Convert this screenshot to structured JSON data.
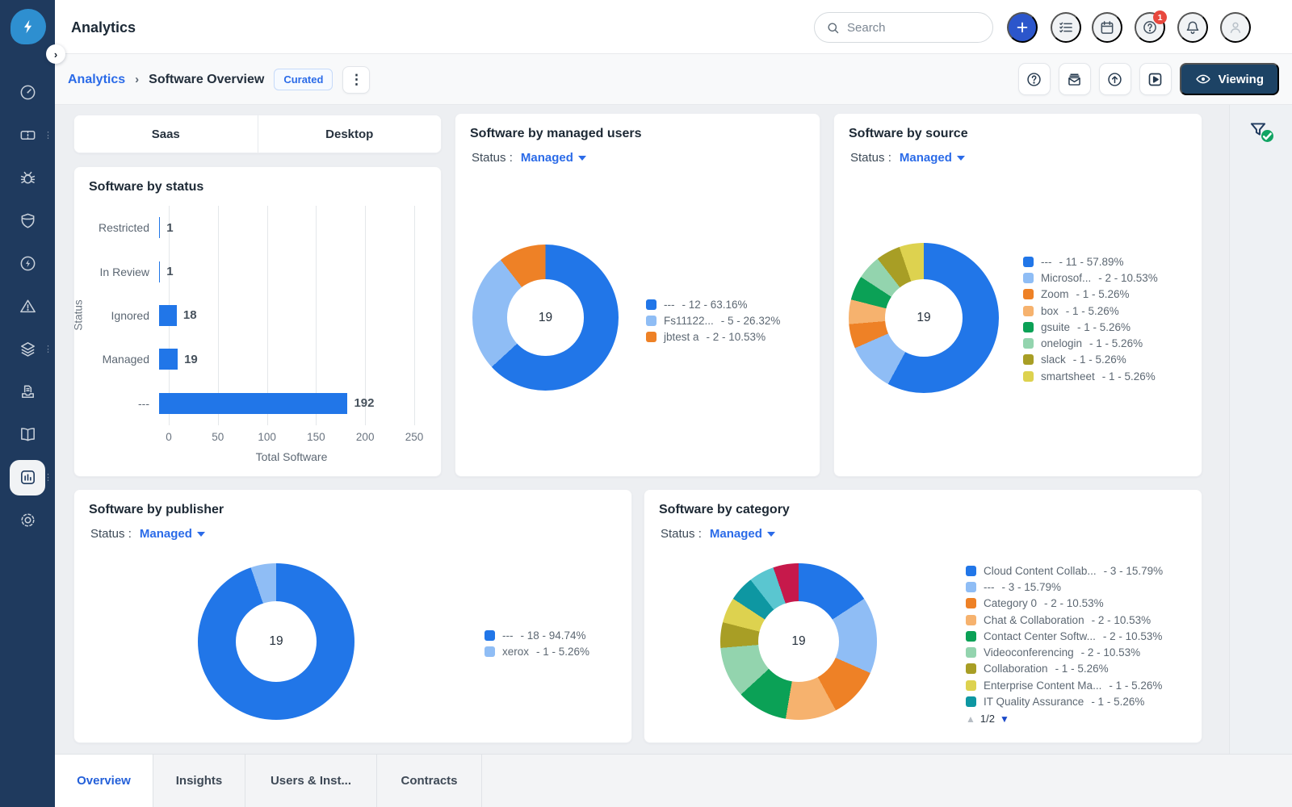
{
  "topbar": {
    "title": "Analytics",
    "search_placeholder": "Search",
    "notification_count": "1",
    "icons": [
      "plus-icon",
      "checklist-icon",
      "calendar-icon",
      "help-icon",
      "bell-icon",
      "user-icon"
    ]
  },
  "breadcrumb": {
    "section": "Analytics",
    "separator": "›",
    "page": "Software Overview",
    "badge": "Curated",
    "viewing_label": "Viewing",
    "action_icons": [
      "help-icon",
      "email-digest-icon",
      "export-icon",
      "video-icon"
    ]
  },
  "sidebar": {
    "items": [
      "dashboard",
      "licenses",
      "bugs",
      "security",
      "energy",
      "alerts",
      "integrations",
      "requests",
      "library",
      "analytics",
      "settings"
    ],
    "active": "analytics"
  },
  "rightrail": {
    "icon": "filter-applied-icon"
  },
  "platform_tabs": [
    "Saas",
    "Desktop"
  ],
  "bottom_tabs": [
    "Overview",
    "Insights",
    "Users & Inst...",
    "Contracts"
  ],
  "bottom_tabs_active": "Overview",
  "filter": {
    "label": "Status :",
    "value": "Managed"
  },
  "cards": {
    "status": {
      "title": "Software by status"
    },
    "managed_users": {
      "title": "Software by managed users"
    },
    "source": {
      "title": "Software by source"
    },
    "publisher": {
      "title": "Software by publisher"
    },
    "category": {
      "title": "Software by category",
      "pagination": "1/2"
    }
  },
  "colors": {
    "sidebar_navy": "#1f3a5e",
    "accent_blue": "#2b6be8",
    "bar_blue": "#2176e8",
    "viewing_navy": "#1d4365",
    "badge_red": "#e8483e",
    "check_green": "#12a463"
  },
  "chart_data": [
    {
      "id": "status",
      "type": "bar",
      "title": "Software by status",
      "orientation": "horizontal",
      "categories": [
        "Restricted",
        "In Review",
        "Ignored",
        "Managed",
        "---"
      ],
      "values": [
        1,
        1,
        18,
        19,
        192
      ],
      "xlabel": "Total Software",
      "ylabel": "Status",
      "xlim": [
        0,
        250
      ],
      "xticks": [
        0,
        50,
        100,
        150,
        200,
        250
      ],
      "bar_color": "#2176e8",
      "grid": true
    },
    {
      "id": "managed_users",
      "type": "donut",
      "title": "Software by managed users",
      "filter": {
        "label": "Status",
        "value": "Managed"
      },
      "total": 19,
      "slices": [
        {
          "label": "---",
          "value": 12,
          "pct": "63.16%",
          "color": "#2176e8"
        },
        {
          "label": "Fs11122...",
          "value": 5,
          "pct": "26.32%",
          "color": "#8fbdf5"
        },
        {
          "label": "jbtest a",
          "value": 2,
          "pct": "10.53%",
          "color": "#ee8126"
        }
      ],
      "legend_position": "right"
    },
    {
      "id": "source",
      "type": "donut",
      "title": "Software by source",
      "filter": {
        "label": "Status",
        "value": "Managed"
      },
      "total": 19,
      "slices": [
        {
          "label": "---",
          "value": 11,
          "pct": "57.89%",
          "color": "#2176e8"
        },
        {
          "label": "Microsof...",
          "value": 2,
          "pct": "10.53%",
          "color": "#8fbdf5"
        },
        {
          "label": "Zoom",
          "value": 1,
          "pct": "5.26%",
          "color": "#ee8126"
        },
        {
          "label": "box",
          "value": 1,
          "pct": "5.26%",
          "color": "#f6b26e"
        },
        {
          "label": "gsuite",
          "value": 1,
          "pct": "5.26%",
          "color": "#0ba156"
        },
        {
          "label": "onelogin",
          "value": 1,
          "pct": "5.26%",
          "color": "#93d4ae"
        },
        {
          "label": "slack",
          "value": 1,
          "pct": "5.26%",
          "color": "#a89e25"
        },
        {
          "label": "smartsheet",
          "value": 1,
          "pct": "5.26%",
          "color": "#ddd24f"
        }
      ],
      "legend_position": "right"
    },
    {
      "id": "publisher",
      "type": "donut",
      "title": "Software by publisher",
      "filter": {
        "label": "Status",
        "value": "Managed"
      },
      "total": 19,
      "slices": [
        {
          "label": "---",
          "value": 18,
          "pct": "94.74%",
          "color": "#2176e8"
        },
        {
          "label": "xerox",
          "value": 1,
          "pct": "5.26%",
          "color": "#8fbdf5"
        }
      ],
      "legend_position": "right"
    },
    {
      "id": "category",
      "type": "donut",
      "title": "Software by category",
      "filter": {
        "label": "Status",
        "value": "Managed"
      },
      "total": 19,
      "legend_pagination": "1/2",
      "slices": [
        {
          "label": "Cloud Content Collab...",
          "value": 3,
          "pct": "15.79%",
          "color": "#2176e8"
        },
        {
          "label": "---",
          "value": 3,
          "pct": "15.79%",
          "color": "#8fbdf5"
        },
        {
          "label": "Category 0",
          "value": 2,
          "pct": "10.53%",
          "color": "#ee8126"
        },
        {
          "label": "Chat & Collaboration",
          "value": 2,
          "pct": "10.53%",
          "color": "#f6b26e"
        },
        {
          "label": "Contact Center Softw...",
          "value": 2,
          "pct": "10.53%",
          "color": "#0ba156"
        },
        {
          "label": "Videoconferencing",
          "value": 2,
          "pct": "10.53%",
          "color": "#93d4ae"
        },
        {
          "label": "Collaboration",
          "value": 1,
          "pct": "5.26%",
          "color": "#a89e25"
        },
        {
          "label": "Enterprise Content Ma...",
          "value": 1,
          "pct": "5.26%",
          "color": "#ddd24f"
        },
        {
          "label": "IT Quality Assurance",
          "value": 1,
          "pct": "5.26%",
          "color": "#0e97a2"
        },
        {
          "label": "",
          "value": 1,
          "pct": "5.26%",
          "color": "#5ac6d0",
          "legend": false
        },
        {
          "label": "",
          "value": 1,
          "pct": "5.26%",
          "color": "#c6194b",
          "legend": false
        }
      ],
      "legend_position": "right"
    }
  ]
}
